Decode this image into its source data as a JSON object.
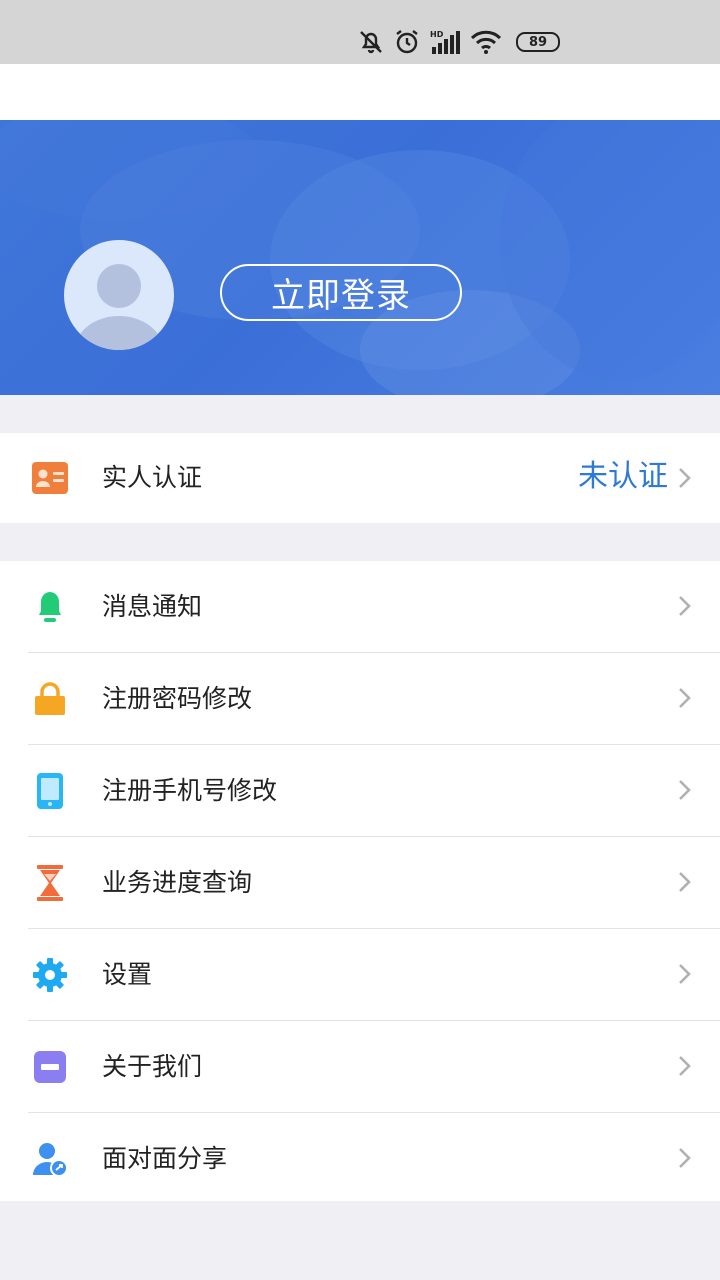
{
  "status_bar": {
    "battery": "89",
    "network": "HD"
  },
  "hero": {
    "login_label": "立即登录"
  },
  "verification": {
    "label": "实人认证",
    "status": "未认证"
  },
  "menu": [
    {
      "label": "消息通知",
      "icon": "bell-icon",
      "color": "#2ecc71"
    },
    {
      "label": "注册密码修改",
      "icon": "lock-icon",
      "color": "#f5a623"
    },
    {
      "label": "注册手机号修改",
      "icon": "phone-icon",
      "color": "#29b6f6"
    },
    {
      "label": "业务进度查询",
      "icon": "hourglass-icon",
      "color": "#f26b3a"
    },
    {
      "label": "设置",
      "icon": "gear-icon",
      "color": "#1fa9f0"
    },
    {
      "label": "关于我们",
      "icon": "info-card-icon",
      "color": "#8a7ef0"
    },
    {
      "label": "面对面分享",
      "icon": "share-user-icon",
      "color": "#3d8ff0"
    }
  ],
  "colors": {
    "accent": "#2c7ad6",
    "hero": "#3f77d9",
    "background": "#efeff4"
  }
}
